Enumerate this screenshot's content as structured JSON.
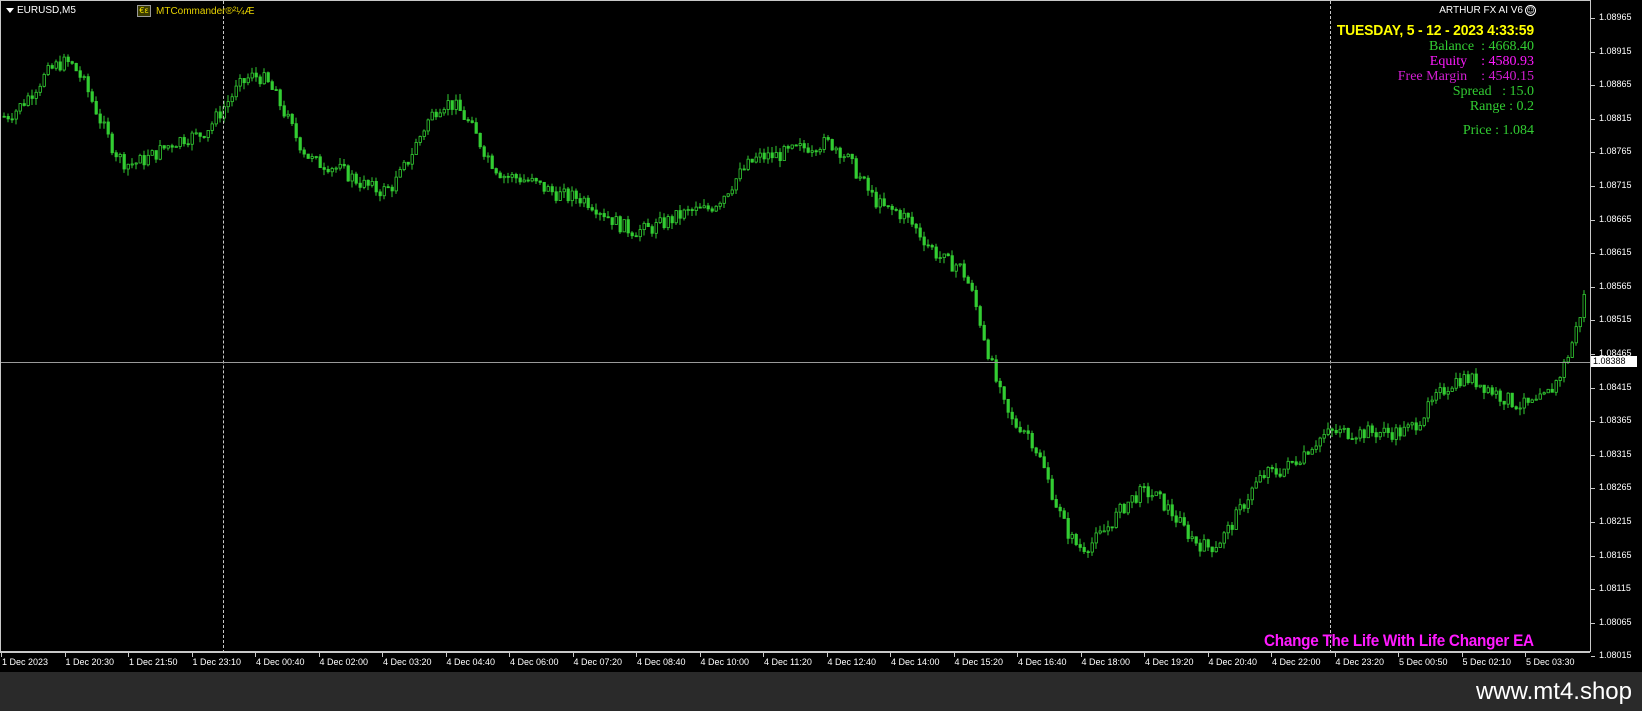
{
  "chart": {
    "symbol": "EURUSD,M5",
    "expert_icon": "ea-icon",
    "expert_name": "MTCommander®²¼Æ",
    "ea_name": "ARTHUR FX AI V6",
    "ea_status_icon": "smiley-icon",
    "bid_price": "1.08388",
    "colors": {
      "background": "#000000",
      "candles": "#32cd32",
      "axis": "#c8c8c8",
      "bid_line": "#9a9a9a"
    }
  },
  "info_panel": {
    "datetime": "TUESDAY, 5 - 12 - 2023 4:33:59",
    "balance": "Balance  : 4668.40",
    "equity": "Equity    : 4580.93",
    "free_margin": "Free Margin    : 4540.15",
    "spread": "Spread   : 15.0",
    "range": "Range : 0.2",
    "price": "Price : 1.084",
    "tagline": "Change The Life With Life Changer EA"
  },
  "price_axis": {
    "labels": [
      "1.08965",
      "1.08915",
      "1.08865",
      "1.08815",
      "1.08765",
      "1.08715",
      "1.08665",
      "1.08615",
      "1.08565",
      "1.08515",
      "1.08465",
      "1.08415",
      "1.08365",
      "1.08315",
      "1.08265",
      "1.08215",
      "1.08165",
      "1.08115",
      "1.08065",
      "1.08015"
    ]
  },
  "time_axis": {
    "labels": [
      "1 Dec 2023",
      "1 Dec 20:30",
      "1 Dec 21:50",
      "1 Dec 23:10",
      "4 Dec 00:40",
      "4 Dec 02:00",
      "4 Dec 03:20",
      "4 Dec 04:40",
      "4 Dec 06:00",
      "4 Dec 07:20",
      "4 Dec 08:40",
      "4 Dec 10:00",
      "4 Dec 11:20",
      "4 Dec 12:40",
      "4 Dec 14:00",
      "4 Dec 15:20",
      "4 Dec 16:40",
      "4 Dec 18:00",
      "4 Dec 19:20",
      "4 Dec 20:40",
      "4 Dec 22:00",
      "4 Dec 23:20",
      "5 Dec 00:50",
      "5 Dec 02:10",
      "5 Dec 03:30"
    ]
  },
  "chart_data": {
    "type": "line",
    "xlabel": "",
    "ylabel": "",
    "ylim": [
      1.08,
      1.09
    ],
    "x": [
      "1 Dec 2023",
      "1 Dec 20:30",
      "1 Dec 21:50",
      "1 Dec 23:10",
      "4 Dec 00:40",
      "4 Dec 02:00",
      "4 Dec 03:20",
      "4 Dec 04:40",
      "4 Dec 06:00",
      "4 Dec 07:20",
      "4 Dec 08:40",
      "4 Dec 10:00",
      "4 Dec 11:20",
      "4 Dec 12:40",
      "4 Dec 14:00",
      "4 Dec 15:20",
      "4 Dec 16:40",
      "4 Dec 18:00",
      "4 Dec 19:20",
      "4 Dec 20:40",
      "4 Dec 22:00",
      "4 Dec 23:20",
      "5 Dec 00:50",
      "5 Dec 02:10",
      "5 Dec 03:30"
    ],
    "series": [
      {
        "values": [
          1.0882,
          1.089,
          1.0875,
          1.0879,
          1.0888,
          1.0875,
          1.0871,
          1.0884,
          1.0873,
          1.087,
          1.0865,
          1.0868,
          1.0876,
          1.0878,
          1.0868,
          1.086,
          1.0836,
          1.0818,
          1.0826,
          1.0818,
          1.0829,
          1.0835,
          1.0835,
          1.0843,
          1.0839
        ]
      }
    ]
  }
}
